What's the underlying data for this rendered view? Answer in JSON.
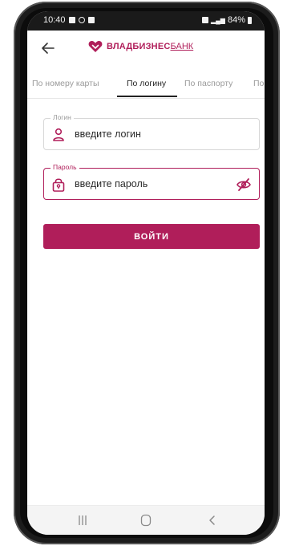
{
  "status_bar": {
    "time": "10:40",
    "battery": "84%"
  },
  "app_bar": {
    "logo_bold": "ВЛАДБИЗНЕС",
    "logo_light": "БАНК"
  },
  "tabs": [
    {
      "label": "По номеру карты"
    },
    {
      "label": "По логину"
    },
    {
      "label": "По паспорту"
    },
    {
      "label": "По с"
    }
  ],
  "login_field": {
    "label": "Логин",
    "placeholder": "введите логин"
  },
  "password_field": {
    "label": "Пароль",
    "placeholder": "введите пароль"
  },
  "submit_button": {
    "label": "ВОЙТИ"
  },
  "colors": {
    "brand": "#b01e5a"
  },
  "icons": [
    "back-arrow-icon",
    "user-icon",
    "lock-icon",
    "eye-off-icon",
    "recents-icon",
    "home-icon",
    "back-nav-icon"
  ]
}
